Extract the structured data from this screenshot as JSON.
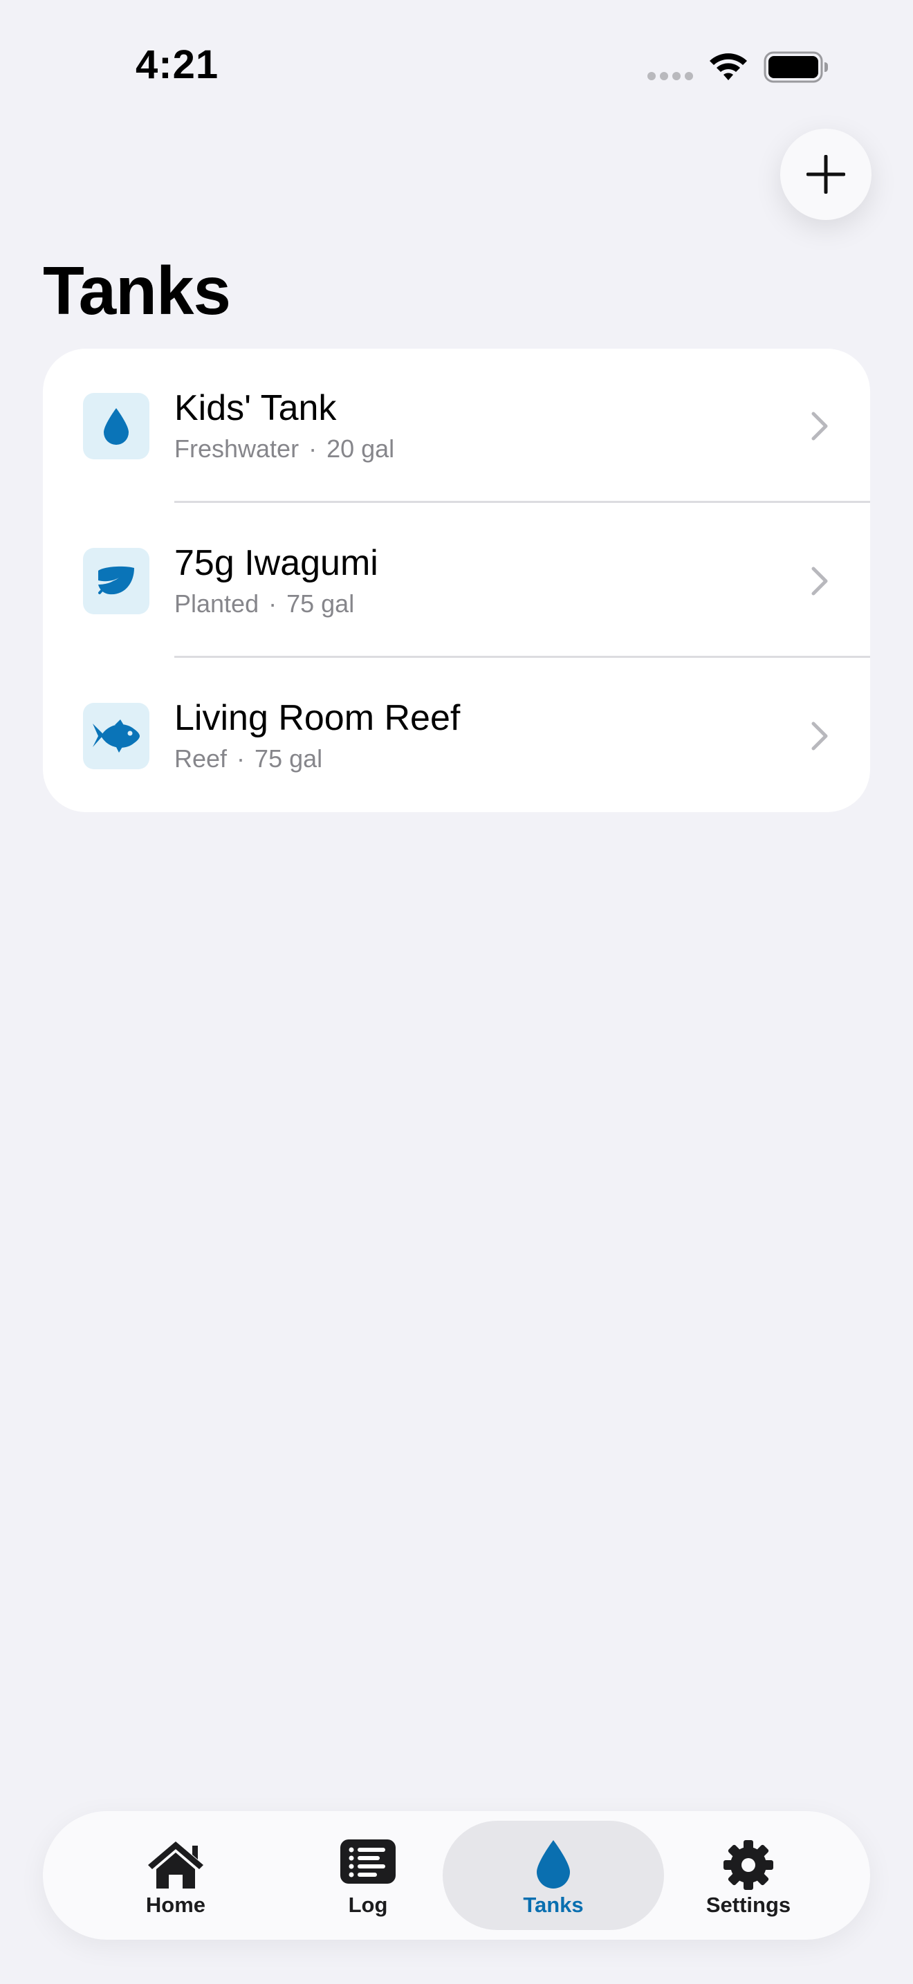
{
  "status_bar": {
    "time": "4:21"
  },
  "header": {
    "title": "Tanks",
    "add_button_icon": "plus-icon"
  },
  "tanks": [
    {
      "name": "Kids' Tank",
      "type": "Freshwater",
      "separator": "·",
      "volume": "20 gal",
      "icon": "water-drop-icon"
    },
    {
      "name": "75g Iwagumi",
      "type": "Planted",
      "separator": "·",
      "volume": "75 gal",
      "icon": "leaf-icon"
    },
    {
      "name": "Living Room Reef",
      "type": "Reef",
      "separator": "·",
      "volume": "75 gal",
      "icon": "fish-icon"
    }
  ],
  "tab_bar": {
    "items": [
      {
        "label": "Home",
        "icon": "house-icon",
        "active": false
      },
      {
        "label": "Log",
        "icon": "list-icon",
        "active": false
      },
      {
        "label": "Tanks",
        "icon": "water-drop-icon",
        "active": true
      },
      {
        "label": "Settings",
        "icon": "gear-icon",
        "active": false
      }
    ]
  },
  "colors": {
    "accent": "#0a6fb0",
    "icon_tile": "#dff0f8",
    "background": "#f2f2f7"
  }
}
